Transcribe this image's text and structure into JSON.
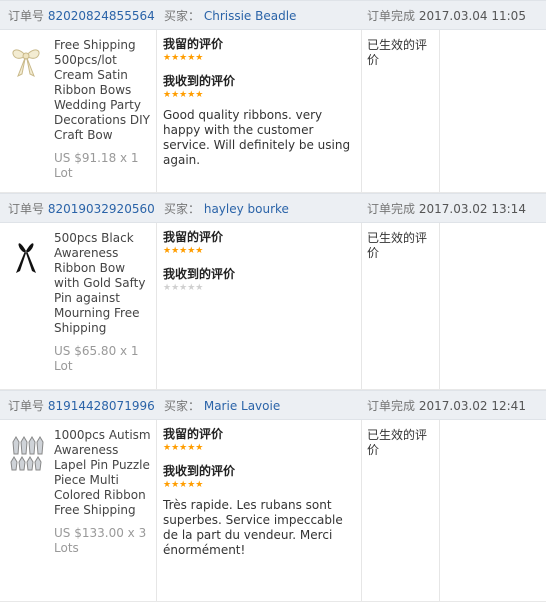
{
  "labels": {
    "order_no": "订单号",
    "buyer": "买家：",
    "order_done": "订单完成",
    "my_review": "我留的评价",
    "received_review": "我收到的评价"
  },
  "orders": [
    {
      "order_id": "82020824855564",
      "buyer": "Chrissie Beadle",
      "date": "2017.03.04 11:05",
      "title": "Free Shipping 500pcs/lot Cream Satin Ribbon Bows Wedding Party Decorations DIY Craft Bow",
      "price": "US $91.18 x 1 Lot",
      "my_stars": 5,
      "received_stars": 5,
      "received_text": "Good quality ribbons. very happy with the customer service. Will definitely be using again.",
      "status": "已生效的评价"
    },
    {
      "order_id": "82019032920560",
      "buyer": "hayley bourke",
      "date": "2017.03.02 13:14",
      "title": "500pcs Black Awareness Ribbon Bow with Gold Safty Pin against Mourning Free Shipping",
      "price": "US $65.80 x 1 Lot",
      "my_stars": 5,
      "received_stars": 0,
      "received_text": "",
      "status": "已生效的评价"
    },
    {
      "order_id": "81914428071996",
      "buyer": "Marie Lavoie",
      "date": "2017.03.02 12:41",
      "title": "1000pcs Autism Awareness Lapel Pin Puzzle Piece Multi Colored Ribbon Free Shipping",
      "price": "US $133.00 x 3 Lots",
      "my_stars": 5,
      "received_stars": 5,
      "received_text": "Très rapide. Les rubans sont superbes. Service impeccable de la part du vendeur. Merci énormément!",
      "status": "已生效的评价"
    }
  ],
  "colors": {
    "header_bg": "#eceff3",
    "link": "#2a63a8",
    "star": "#ff9d00"
  }
}
